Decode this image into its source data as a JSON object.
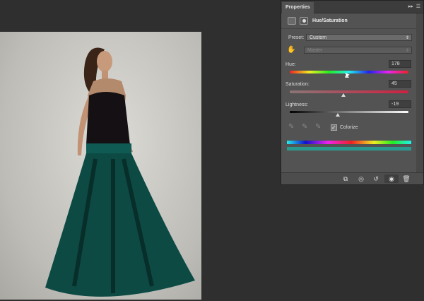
{
  "panel": {
    "tab": "Properties",
    "title": "Hue/Saturation",
    "preset_label": "Preset:",
    "preset_value": "Custom",
    "channel_value": "Master",
    "hue_label": "Hue:",
    "hue_value": "178",
    "hue_fraction": 0.5,
    "saturation_label": "Saturation:",
    "saturation_value": "45",
    "saturation_fraction": 0.45,
    "lightness_label": "Lightness:",
    "lightness_value": "-19",
    "lightness_fraction": 0.4,
    "colorize_label": "Colorize",
    "colorize_checked": true
  },
  "colors": {
    "dress": "#0d4a44",
    "result_bar": "#2a9a90"
  }
}
